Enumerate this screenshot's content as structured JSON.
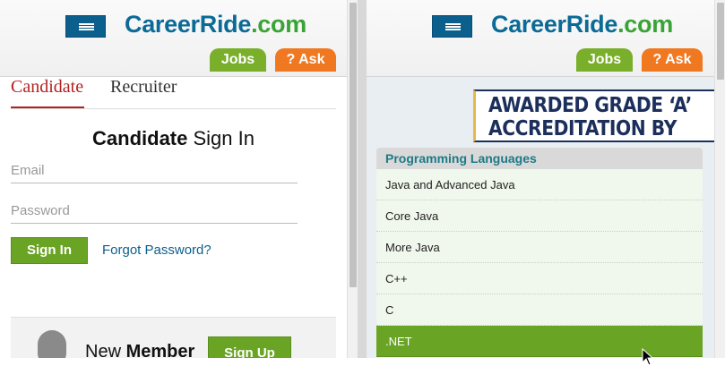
{
  "left": {
    "logo": {
      "main": "CareerRide",
      "tld": ".com"
    },
    "tabs": {
      "jobs": "Jobs",
      "ask": "? Ask"
    },
    "role_tabs": {
      "candidate": "Candidate",
      "recruiter": "Recruiter"
    },
    "signin": {
      "title_bold": "Candidate",
      "title_rest": " Sign In"
    },
    "form": {
      "email_placeholder": "Email",
      "password_placeholder": "Password",
      "signin_label": "Sign In",
      "forgot_label": "Forgot Password?"
    },
    "member": {
      "new": "New ",
      "bold": "Member",
      "signup_label": "Sign Up"
    }
  },
  "right": {
    "logo": {
      "main": "CareerRide",
      "tld": ".com"
    },
    "tabs": {
      "jobs": "Jobs",
      "ask": "? Ask"
    },
    "banner": {
      "line1": "AWARDED GRADE ‘A’",
      "line2": "ACCREDITATION BY"
    },
    "languages": {
      "heading": "Programming Languages",
      "items": [
        "Java and Advanced Java",
        "Core Java",
        "More Java",
        "C++",
        "C",
        ".NET"
      ],
      "active_index": 5
    }
  },
  "colors": {
    "brand_blue": "#0b6a96",
    "brand_green": "#3aa335",
    "button_green": "#6aa425",
    "ask_orange": "#f07820",
    "heading_teal": "#1d7a87"
  },
  "icons": [
    "menu-icon",
    "avatar-icon",
    "mouse-pointer-icon"
  ]
}
